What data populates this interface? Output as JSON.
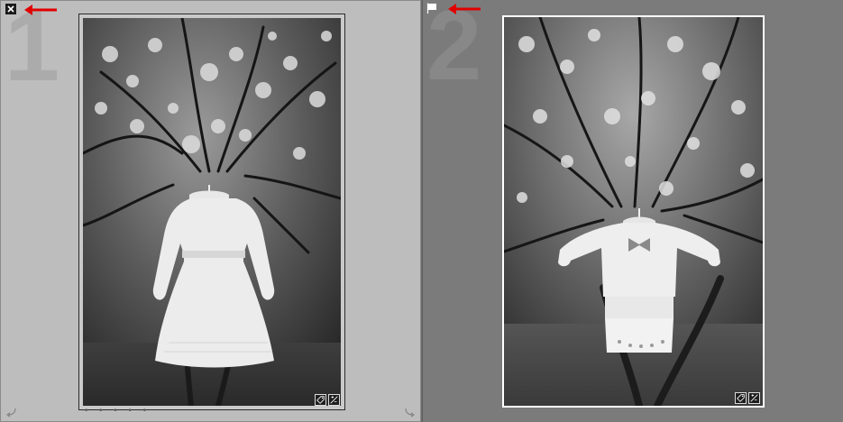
{
  "cells": [
    {
      "index": "1",
      "flag": "rejected-flag-icon",
      "rating_dots": "• • • • •",
      "selected": true
    },
    {
      "index": "2",
      "flag": "picked-flag-icon",
      "selected": false
    }
  ],
  "colors": {
    "annotation_arrow": "#e00000",
    "selected_cell_bg": "#bdbdbd",
    "unselected_cell_bg": "#7b7b7b"
  }
}
